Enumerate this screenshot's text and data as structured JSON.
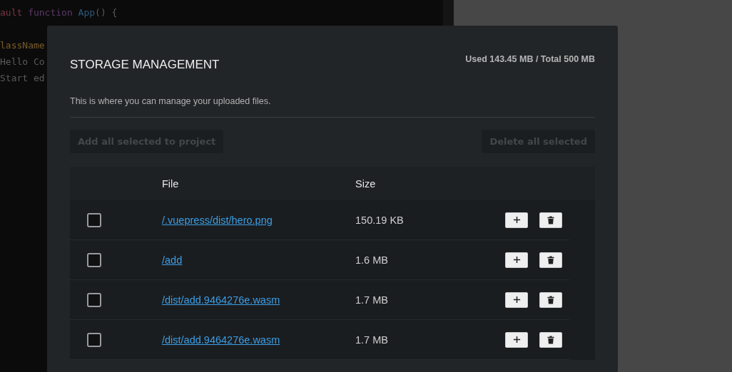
{
  "editor": {
    "lines": [
      {
        "parts": [
          {
            "text": "ault ",
            "kind": "keyword"
          },
          {
            "text": "function ",
            "kind": "keyword2"
          },
          {
            "text": "App",
            "kind": "name"
          },
          {
            "text": "() {",
            "kind": "plain"
          }
        ]
      },
      {
        "blank_before": true,
        "parts": [
          {
            "text": "lassName",
            "kind": "attr"
          }
        ]
      },
      {
        "parts": [
          {
            "text": "Hello Co",
            "kind": "plain"
          }
        ]
      },
      {
        "parts": [
          {
            "text": "Start ed",
            "kind": "plain"
          }
        ]
      }
    ]
  },
  "modal": {
    "title": "STORAGE MANAGEMENT",
    "usage": "Used 143.45 MB / Total 500 MB",
    "description": "This is where you can manage your uploaded files.",
    "actions": [
      {
        "label": "Add all selected to project",
        "disabled": true
      },
      {
        "label": "Delete all selected",
        "disabled": true
      }
    ],
    "table": {
      "columns": [
        "File",
        "Size"
      ],
      "rows": [
        {
          "checked": false,
          "file": "/.vuepress/dist/hero.png",
          "size": "150.19 KB"
        },
        {
          "checked": false,
          "file": "/add",
          "size": "1.6 MB"
        },
        {
          "checked": false,
          "file": "/dist/add.9464276e.wasm",
          "size": "1.7 MB"
        },
        {
          "checked": false,
          "file": "/dist/add.9464276e.wasm",
          "size": "1.7 MB"
        }
      ]
    }
  }
}
